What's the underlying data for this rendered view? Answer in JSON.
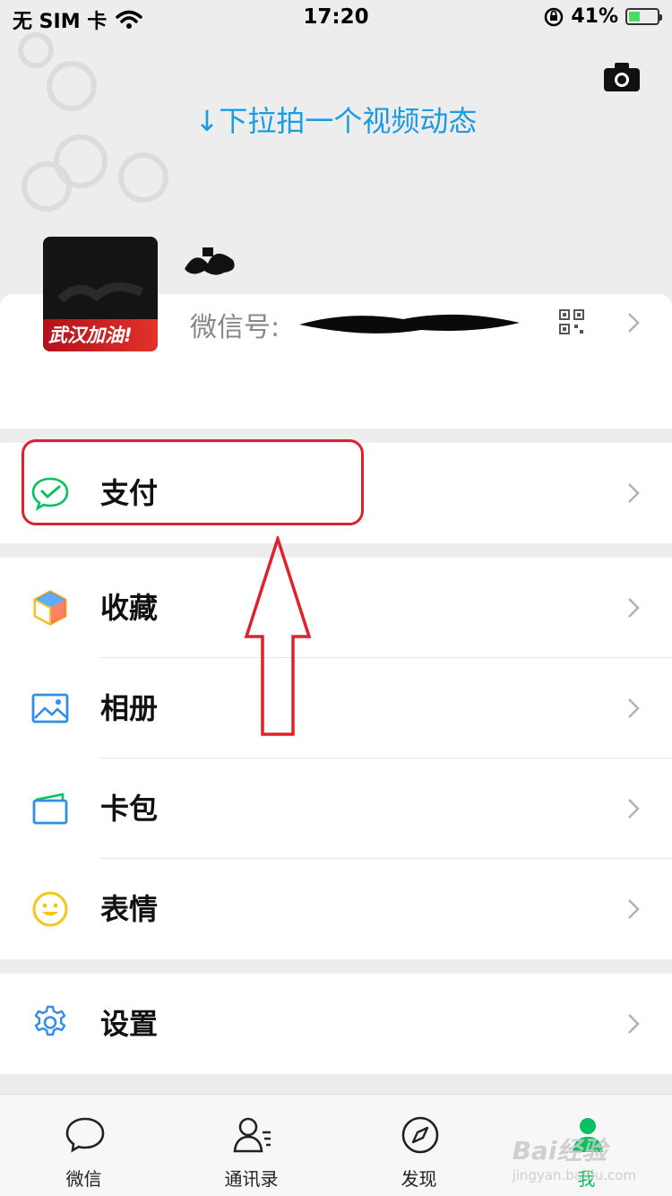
{
  "status_bar": {
    "carrier": "无 SIM 卡",
    "time": "17:20",
    "battery_percent": "41%",
    "battery_level": 0.41
  },
  "header": {
    "pull_hint": "↓下拉拍一个视频动态",
    "camera_icon": "camera-icon"
  },
  "profile": {
    "avatar_banner": "武汉加油!",
    "wechat_id_label": "微信号:",
    "qr_icon": "qr-code-icon"
  },
  "menu": {
    "pay": {
      "label": "支付",
      "icon": "wechat-pay-icon"
    },
    "favorites": {
      "label": "收藏",
      "icon": "favorites-cube-icon"
    },
    "album": {
      "label": "相册",
      "icon": "album-picture-icon"
    },
    "cards": {
      "label": "卡包",
      "icon": "card-wallet-icon"
    },
    "stickers": {
      "label": "表情",
      "icon": "smiley-icon"
    },
    "settings": {
      "label": "设置",
      "icon": "gear-icon"
    }
  },
  "tabs": [
    {
      "label": "微信",
      "icon": "chat-bubble-icon",
      "active": false
    },
    {
      "label": "通讯录",
      "icon": "contacts-icon",
      "active": false
    },
    {
      "label": "发现",
      "icon": "compass-icon",
      "active": false
    },
    {
      "label": "我",
      "icon": "person-icon",
      "active": true
    }
  ],
  "watermark": {
    "text": "Bai经验",
    "sub": "jingyan.baidu.com"
  },
  "colors": {
    "accent_green": "#07c160",
    "link_blue": "#1b9ce0",
    "annotation_red": "#e0212b",
    "background": "#ededed"
  }
}
